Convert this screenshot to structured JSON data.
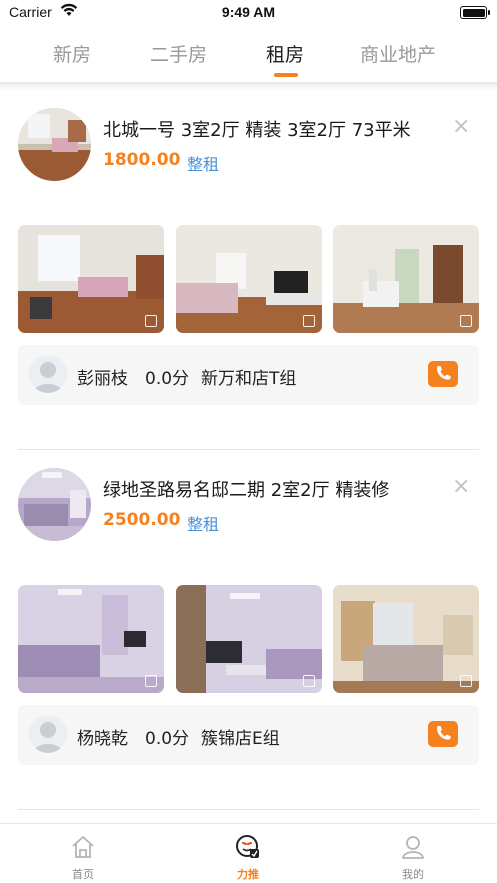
{
  "status_bar": {
    "carrier": "Carrier",
    "time": "9:49 AM"
  },
  "tabs": [
    {
      "label": "新房",
      "active": false
    },
    {
      "label": "二手房",
      "active": false
    },
    {
      "label": "租房",
      "active": true
    },
    {
      "label": "商业地产",
      "active": false
    }
  ],
  "listings": [
    {
      "title": "北城一号 3室2厅 精装 3室2厅 73平米",
      "price": "1800.00",
      "rent_type": "整租",
      "close_icon": "close-icon",
      "agent": {
        "name": "彭丽枝",
        "score": "0.0分",
        "store": "新万和店T组"
      }
    },
    {
      "title": "绿地圣路易名邸二期 2室2厅 精装修",
      "price": "2500.00",
      "rent_type": "整租",
      "close_icon": "close-icon",
      "agent": {
        "name": "杨晓乾",
        "score": "0.0分",
        "store": "簇锦店E组"
      }
    }
  ],
  "bottom_nav": [
    {
      "label": "首页",
      "icon": "home-icon",
      "active": false
    },
    {
      "label": "力推",
      "icon": "recommend-icon",
      "active": true
    },
    {
      "label": "我的",
      "icon": "user-icon",
      "active": false
    }
  ],
  "colors": {
    "accent": "#f5821f",
    "link": "#4a90d9"
  }
}
